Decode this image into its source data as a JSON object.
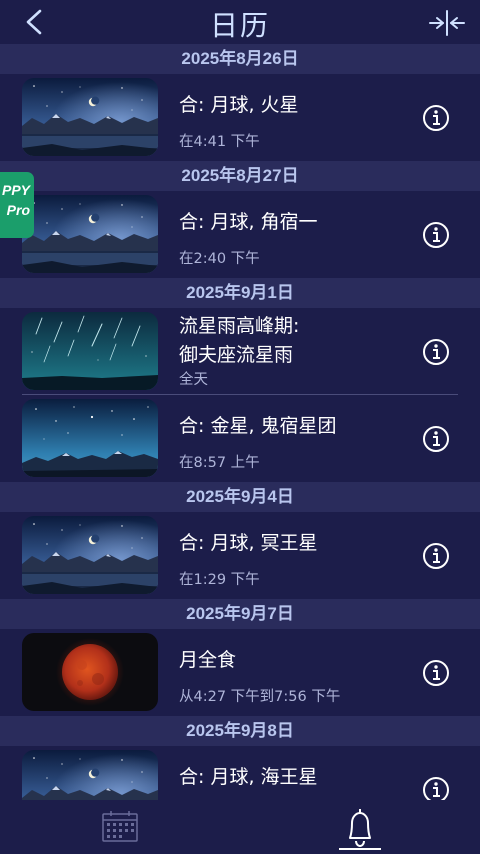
{
  "header": {
    "title": "日历",
    "back_icon": "chevron-left-icon",
    "right_icon": "compress-arrows-icon"
  },
  "promo": {
    "line1": "PPY",
    "line2": "Pro"
  },
  "sections": [
    {
      "date": "2025年8月26日",
      "events": [
        {
          "title": "合: 月球, 火星",
          "time": "在4:41 下午",
          "thumb": "moon-mountains"
        }
      ]
    },
    {
      "date": "2025年8月27日",
      "events": [
        {
          "title": "合: 月球, 角宿一",
          "time": "在2:40 下午",
          "thumb": "moon-mountains"
        }
      ]
    },
    {
      "date": "2025年9月1日",
      "events": [
        {
          "title_line1": "流星雨高峰期:",
          "title_line2": "御夫座流星雨",
          "time": "全天",
          "thumb": "meteor-shower"
        },
        {
          "title": "合: 金星, 鬼宿星团",
          "time": "在8:57 上午",
          "thumb": "starry-mountains"
        }
      ]
    },
    {
      "date": "2025年9月4日",
      "events": [
        {
          "title": "合: 月球, 冥王星",
          "time": "在1:29 下午",
          "thumb": "moon-mountains"
        }
      ]
    },
    {
      "date": "2025年9月7日",
      "events": [
        {
          "title": "月全食",
          "time": "从4:27 下午到7:56 下午",
          "thumb": "blood-moon"
        }
      ]
    },
    {
      "date": "2025年9月8日",
      "events": [
        {
          "title": "合: 月球, 海王星",
          "time": "",
          "thumb": "moon-mountains"
        }
      ]
    }
  ],
  "bottom_tabs": [
    {
      "icon": "calendar-icon",
      "selected": false
    },
    {
      "icon": "bell-icon",
      "selected": true
    }
  ],
  "colors": {
    "background": "#1c1d4a",
    "date_bar": "#2a2c5c",
    "date_text": "#b9c6ee",
    "title_text": "#cfe0ff",
    "time_text": "#aeb4d8",
    "promo_green": "#1b9e6b"
  }
}
